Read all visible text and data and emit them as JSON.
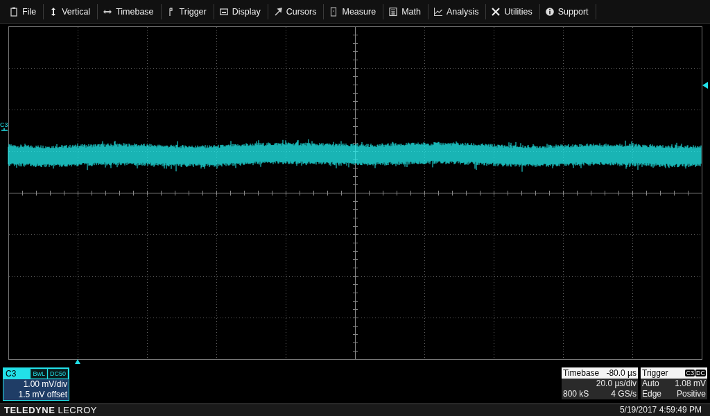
{
  "menu": [
    {
      "label": "File"
    },
    {
      "label": "Vertical"
    },
    {
      "label": "Timebase"
    },
    {
      "label": "Trigger"
    },
    {
      "label": "Display"
    },
    {
      "label": "Cursors"
    },
    {
      "label": "Measure"
    },
    {
      "label": "Math"
    },
    {
      "label": "Analysis"
    },
    {
      "label": "Utilities"
    },
    {
      "label": "Support"
    }
  ],
  "trace": {
    "label": "C3"
  },
  "channel": {
    "name": "C3",
    "badges": [
      "BwL",
      "DC50"
    ],
    "scale": "1.00 mV/div",
    "offset": "1.5 mV offset"
  },
  "timebase": {
    "title": "Timebase",
    "delay": "-80.0 µs",
    "scale": "20.0 µs/div",
    "samples": "800 kS",
    "rate": "4 GS/s"
  },
  "trigger": {
    "title": "Trigger",
    "badges": [
      "C3",
      "DC"
    ],
    "mode": "Auto",
    "level": "1.08 mV",
    "type": "Edge",
    "slope": "Positive"
  },
  "footer": {
    "brand": "**TELEDYNE** LECROY",
    "datetime": "5/19/2017 4:59:49 PM"
  }
}
